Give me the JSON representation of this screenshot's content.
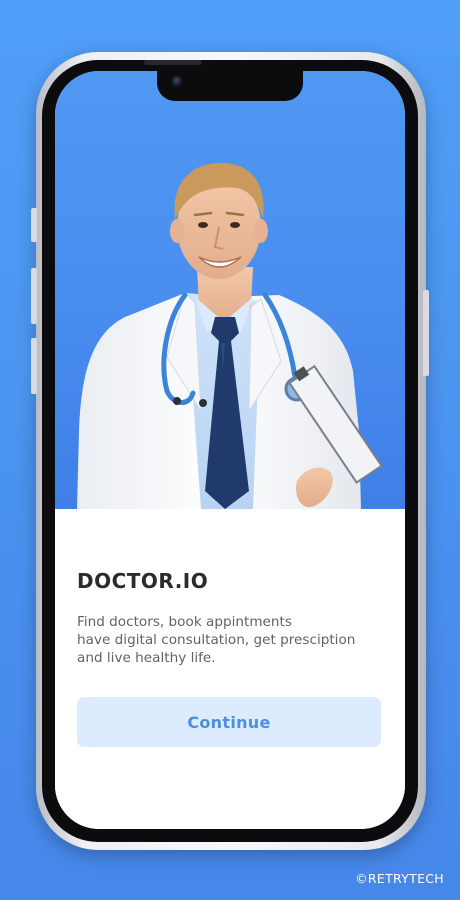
{
  "onboarding": {
    "title": "DOCTOR.IO",
    "description": "Find doctors, book appintments\nhave digital consultation, get presciption\nand live healthy life.",
    "continue_label": "Continue"
  },
  "footer": {
    "copyright": "©RETRYTECH"
  },
  "colors": {
    "background": "#4a92ef",
    "accent": "#4a8fe0",
    "button_bg": "#dcecfe",
    "title": "#2b2b2b",
    "body_text": "#5f6368"
  }
}
